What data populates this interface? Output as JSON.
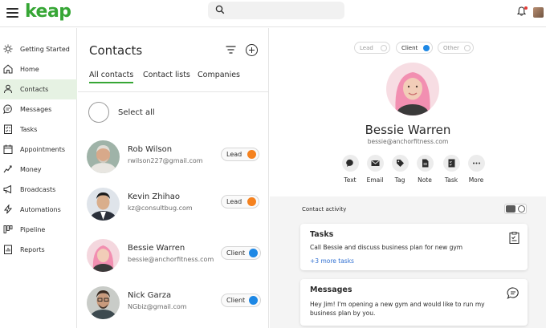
{
  "app": {
    "logo": "keap"
  },
  "header": {
    "search_placeholder": ""
  },
  "sidebar": {
    "items": [
      {
        "label": "Getting Started",
        "icon": "bulb-icon"
      },
      {
        "label": "Home",
        "icon": "home-icon"
      },
      {
        "label": "Contacts",
        "icon": "person-icon",
        "active": true
      },
      {
        "label": "Messages",
        "icon": "chat-icon"
      },
      {
        "label": "Tasks",
        "icon": "checklist-icon"
      },
      {
        "label": "Appointments",
        "icon": "calendar-icon"
      },
      {
        "label": "Money",
        "icon": "money-icon"
      },
      {
        "label": "Broadcasts",
        "icon": "megaphone-icon"
      },
      {
        "label": "Automations",
        "icon": "lightning-icon"
      },
      {
        "label": "Pipeline",
        "icon": "pipeline-icon"
      },
      {
        "label": "Reports",
        "icon": "report-icon"
      }
    ]
  },
  "contacts": {
    "title": "Contacts",
    "tabs": [
      "All contacts",
      "Contact lists",
      "Companies"
    ],
    "select_all": "Select all",
    "rows": [
      {
        "name": "Rob Wilson",
        "email": "rwilson227@gmail.com",
        "status": "Lead",
        "status_color": "#f5821f"
      },
      {
        "name": "Kevin Zhihao",
        "email": "kz@consultbug.com",
        "status": "Lead",
        "status_color": "#f5821f"
      },
      {
        "name": "Bessie Warren",
        "email": "bessie@anchorfitness.com",
        "status": "Client",
        "status_color": "#1e88e5"
      },
      {
        "name": "Nick Garza",
        "email": "NGbiz@gmail.com",
        "status": "Client",
        "status_color": "#1e88e5"
      }
    ]
  },
  "detail": {
    "toggles": [
      {
        "label": "Lead",
        "selected": false
      },
      {
        "label": "Client",
        "selected": true
      },
      {
        "label": "Other",
        "selected": false
      }
    ],
    "name": "Bessie Warren",
    "email": "bessie@anchorfitness.com",
    "actions": [
      "Text",
      "Email",
      "Tag",
      "Note",
      "Task",
      "More"
    ],
    "activity_title": "Contact activity",
    "tasks_card": {
      "title": "Tasks",
      "body": "Call Bessie and discuss business plan for new gym",
      "link": "+3 more tasks"
    },
    "messages_card": {
      "title": "Messages",
      "body_line1": "Hey Jim! I'm opening a new gym and would like to run my",
      "body_line2": "business plan by you."
    }
  },
  "colors": {
    "brand": "#36a635",
    "active_bg": "#e6f2e3",
    "lead": "#f5821f",
    "client": "#1e88e5",
    "link": "#2f6fd1"
  }
}
